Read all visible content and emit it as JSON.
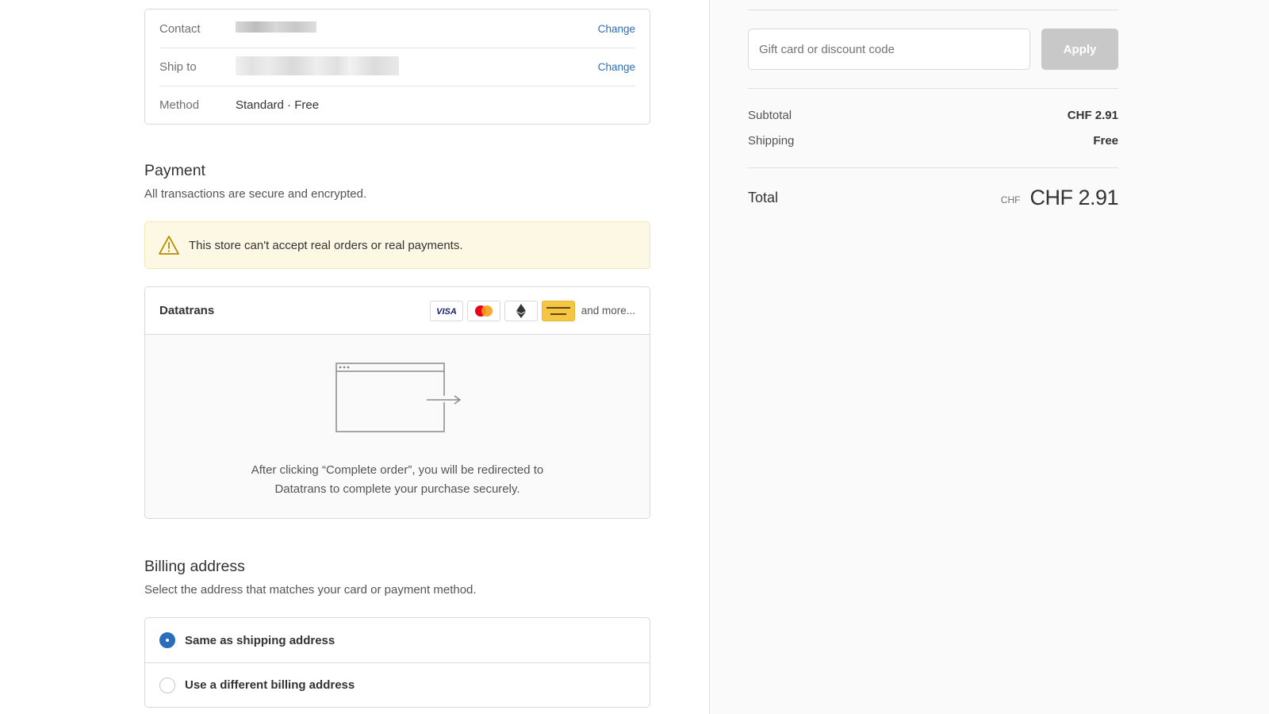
{
  "review": {
    "contact_label": "Contact",
    "ship_to_label": "Ship to",
    "method_label": "Method",
    "method_value": "Standard · Free",
    "change_label": "Change"
  },
  "payment": {
    "title": "Payment",
    "subtitle": "All transactions are secure and encrypted.",
    "warning": "This store can't accept real orders or real payments.",
    "provider": "Datatrans",
    "cards": [
      "visa-icon",
      "mastercard-icon",
      "ethereum-icon",
      "postfinance-icon"
    ],
    "more": "and more...",
    "redirect_line1": "After clicking “Complete order”, you will be redirected to",
    "redirect_line2": "Datatrans to complete your purchase securely."
  },
  "billing": {
    "title": "Billing address",
    "subtitle": "Select the address that matches your card or payment method.",
    "option_same": "Same as shipping address",
    "option_different": "Use a different billing address",
    "selected": "same"
  },
  "summary": {
    "gift_placeholder": "Gift card or discount code",
    "apply_label": "Apply",
    "subtotal_label": "Subtotal",
    "subtotal_value": "CHF 2.91",
    "shipping_label": "Shipping",
    "shipping_value": "Free",
    "total_label": "Total",
    "total_currency": "CHF",
    "total_value": "CHF 2.91"
  },
  "colors": {
    "accent": "#2a6ebb",
    "warning_bg": "#fdf8e3",
    "warning_icon": "#b98900"
  }
}
